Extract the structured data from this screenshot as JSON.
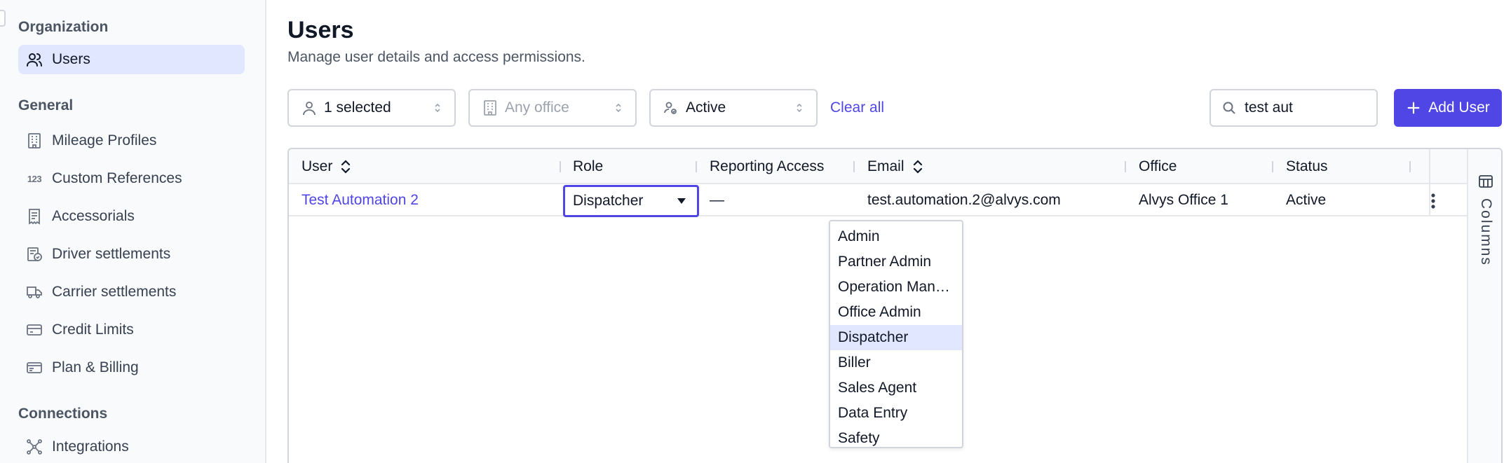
{
  "sidebar": {
    "sections": [
      {
        "heading": "Organization"
      },
      {
        "heading": "General"
      },
      {
        "heading": "Connections"
      }
    ],
    "items": [
      {
        "label": "Users",
        "icon": "users-icon",
        "active": true
      },
      {
        "label": "Mileage Profiles",
        "icon": "building-icon"
      },
      {
        "label": "Custom References",
        "icon": "numbers-123-icon",
        "icon_text": "123"
      },
      {
        "label": "Accessorials",
        "icon": "receipt-icon"
      },
      {
        "label": "Driver settlements",
        "icon": "settlement-icon"
      },
      {
        "label": "Carrier settlements",
        "icon": "truck-icon"
      },
      {
        "label": "Credit Limits",
        "icon": "credit-card-icon"
      },
      {
        "label": "Plan & Billing",
        "icon": "billing-card-icon"
      },
      {
        "label": "Integrations",
        "icon": "integrations-icon"
      }
    ]
  },
  "header": {
    "title": "Users",
    "subtitle": "Manage user details and access permissions."
  },
  "filters": {
    "user": {
      "value": "1 selected",
      "icon": "user-icon"
    },
    "office": {
      "placeholder": "Any office",
      "icon": "office-building-icon"
    },
    "status": {
      "value": "Active",
      "icon": "user-status-icon"
    },
    "clear_all": "Clear all"
  },
  "search": {
    "value": "test aut",
    "icon": "search-icon"
  },
  "add_user": {
    "label": "Add User",
    "icon": "plus-icon"
  },
  "table": {
    "columns": [
      "User",
      "Role",
      "Reporting Access",
      "Email",
      "Office",
      "Status"
    ],
    "sortable": [
      "User",
      "Email"
    ],
    "rows": [
      {
        "user": "Test Automation 2",
        "role": "Dispatcher",
        "reporting_access": "—",
        "email": "test.automation.2@alvys.com",
        "office": "Alvys Office 1",
        "status": "Active"
      }
    ],
    "columns_panel_label": "Columns"
  },
  "role_dropdown": {
    "selected": "Dispatcher",
    "options": [
      "Admin",
      "Partner Admin",
      "Operation Man…",
      "Office Admin",
      "Dispatcher",
      "Biller",
      "Sales Agent",
      "Data Entry",
      "Safety"
    ]
  },
  "colors": {
    "accent": "#4f46e5",
    "active_bg": "#e0e7ff",
    "border": "#d1d5db"
  }
}
